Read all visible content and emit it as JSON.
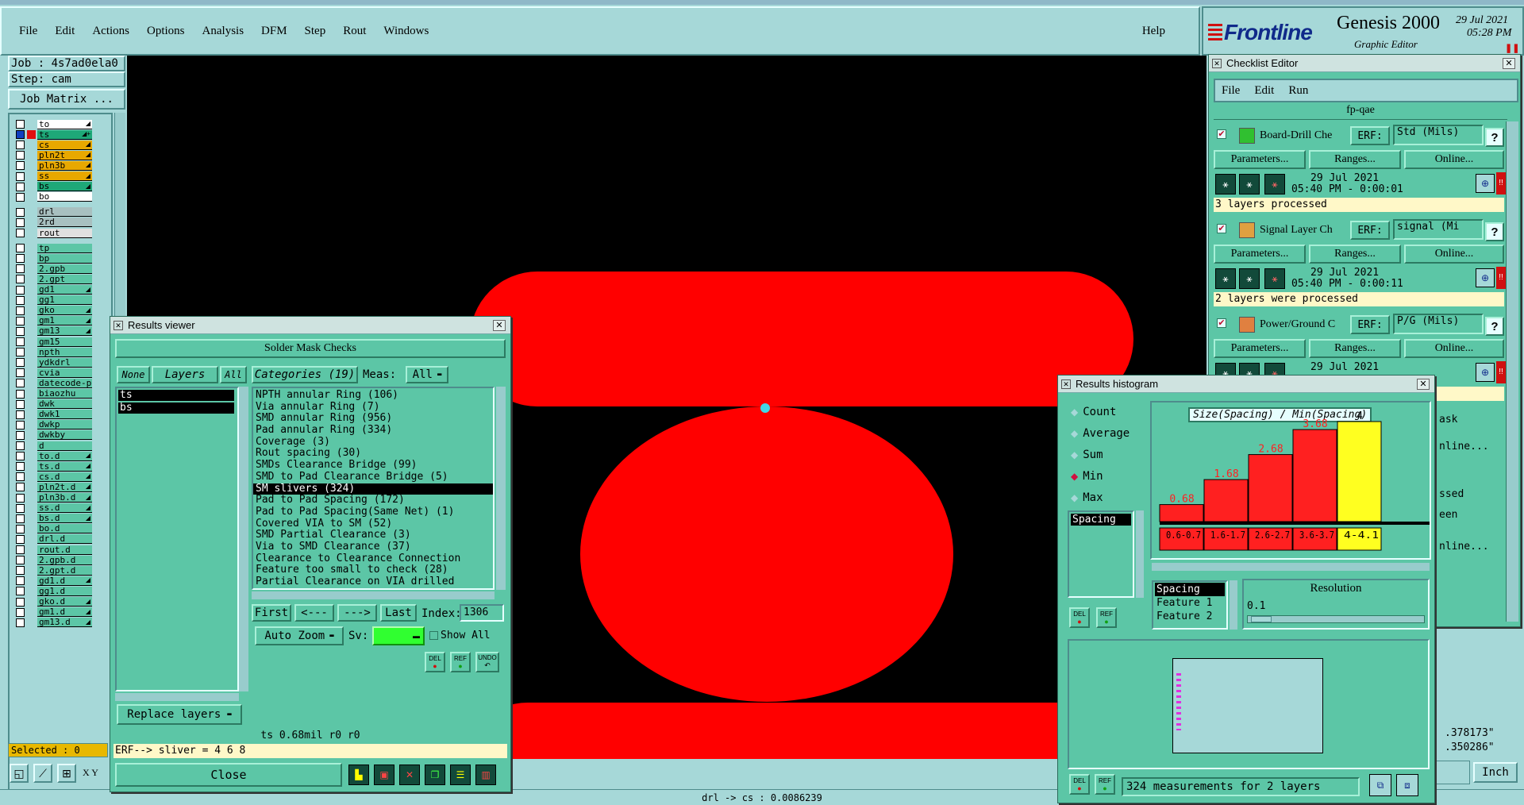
{
  "app": {
    "menu": [
      "File",
      "Edit",
      "Actions",
      "Options",
      "Analysis",
      "DFM",
      "Step",
      "Rout",
      "Windows"
    ],
    "help": "Help",
    "brand": "Frontline",
    "product": "Genesis 2000",
    "subtitle": "Graphic Editor",
    "date": "29 Jul 2021",
    "time": "05:28 PM"
  },
  "job": {
    "job": "Job : 4s7ad0ela0",
    "step": "Step: cam",
    "matrix": "Job Matrix ..."
  },
  "layers": [
    {
      "name": "to",
      "color": "#ffffff",
      "arrow": "◢"
    },
    {
      "name": "ts",
      "color": "#1ea878",
      "arrow": "◢+",
      "active": true
    },
    {
      "name": "cs",
      "color": "#e8a800",
      "arrow": "◢"
    },
    {
      "name": "pln2t",
      "color": "#e8a800",
      "arrow": "◢"
    },
    {
      "name": "pln3b",
      "color": "#e8a800",
      "arrow": "◢"
    },
    {
      "name": "ss",
      "color": "#e8a800",
      "arrow": "◢"
    },
    {
      "name": "bs",
      "color": "#1ea878",
      "arrow": "◢"
    },
    {
      "name": "bo",
      "color": "#ffffff",
      "arrow": ""
    },
    {
      "name": "drl",
      "color": "#a8c0c0",
      "arrow": ""
    },
    {
      "name": "2rd",
      "color": "#a8c0c0",
      "arrow": ""
    },
    {
      "name": "rout",
      "color": "#e0e0e0",
      "arrow": ""
    },
    {
      "name": "tp",
      "color": "#5cc6a6",
      "arrow": ""
    },
    {
      "name": "bp",
      "color": "#5cc6a6",
      "arrow": ""
    },
    {
      "name": "2.gpb",
      "color": "#5cc6a6",
      "arrow": ""
    },
    {
      "name": "2.gpt",
      "color": "#5cc6a6",
      "arrow": ""
    },
    {
      "name": "gd1",
      "color": "#5cc6a6",
      "arrow": "◢"
    },
    {
      "name": "gg1",
      "color": "#5cc6a6",
      "arrow": ""
    },
    {
      "name": "gko",
      "color": "#5cc6a6",
      "arrow": "◢"
    },
    {
      "name": "gm1",
      "color": "#5cc6a6",
      "arrow": "◢"
    },
    {
      "name": "gm13",
      "color": "#5cc6a6",
      "arrow": "◢"
    },
    {
      "name": "gm15",
      "color": "#5cc6a6",
      "arrow": ""
    },
    {
      "name": "npth",
      "color": "#5cc6a6",
      "arrow": ""
    },
    {
      "name": "ydkdrl",
      "color": "#5cc6a6",
      "arrow": ""
    },
    {
      "name": "cvia",
      "color": "#5cc6a6",
      "arrow": ""
    },
    {
      "name": "datecode-pt",
      "color": "#5cc6a6",
      "arrow": ""
    },
    {
      "name": "biaozhu",
      "color": "#5cc6a6",
      "arrow": ""
    },
    {
      "name": "dwk",
      "color": "#5cc6a6",
      "arrow": ""
    },
    {
      "name": "dwk1",
      "color": "#5cc6a6",
      "arrow": ""
    },
    {
      "name": "dwkp",
      "color": "#5cc6a6",
      "arrow": ""
    },
    {
      "name": "dwkby",
      "color": "#5cc6a6",
      "arrow": ""
    },
    {
      "name": "d",
      "color": "#5cc6a6",
      "arrow": ""
    },
    {
      "name": "to.d",
      "color": "#5cc6a6",
      "arrow": "◢"
    },
    {
      "name": "ts.d",
      "color": "#5cc6a6",
      "arrow": "◢"
    },
    {
      "name": "cs.d",
      "color": "#5cc6a6",
      "arrow": "◢"
    },
    {
      "name": "pln2t.d",
      "color": "#5cc6a6",
      "arrow": "◢"
    },
    {
      "name": "pln3b.d",
      "color": "#5cc6a6",
      "arrow": "◢"
    },
    {
      "name": "ss.d",
      "color": "#5cc6a6",
      "arrow": "◢"
    },
    {
      "name": "bs.d",
      "color": "#5cc6a6",
      "arrow": "◢"
    },
    {
      "name": "bo.d",
      "color": "#5cc6a6",
      "arrow": ""
    },
    {
      "name": "drl.d",
      "color": "#5cc6a6",
      "arrow": ""
    },
    {
      "name": "rout.d",
      "color": "#5cc6a6",
      "arrow": ""
    },
    {
      "name": "2.gpb.d",
      "color": "#5cc6a6",
      "arrow": ""
    },
    {
      "name": "2.gpt.d",
      "color": "#5cc6a6",
      "arrow": ""
    },
    {
      "name": "gd1.d",
      "color": "#5cc6a6",
      "arrow": "◢"
    },
    {
      "name": "gg1.d",
      "color": "#5cc6a6",
      "arrow": ""
    },
    {
      "name": "gko.d",
      "color": "#5cc6a6",
      "arrow": "◢"
    },
    {
      "name": "gm1.d",
      "color": "#5cc6a6",
      "arrow": "◢"
    },
    {
      "name": "gm13.d",
      "color": "#5cc6a6",
      "arrow": "◢"
    }
  ],
  "selected": "Selected : 0",
  "statusbar": "drl -> cs : 0.0086239",
  "coords": {
    "x": ".378173\"",
    "y": ".350286\"",
    "unit": "Inch"
  },
  "xy_label": "X Y",
  "results_viewer": {
    "title": "Results viewer",
    "header": "Solder Mask Checks",
    "none": "None",
    "layers": "Layers",
    "all": "All",
    "categories_label": "Categories (19)",
    "meas_label": "Meas:",
    "meas_value": "All",
    "layer_list": [
      "ts",
      "bs"
    ],
    "categories": [
      "NPTH annular Ring (106)",
      "Via annular Ring (7)",
      "SMD annular Ring (956)",
      "Pad annular Ring (334)",
      "Coverage (3)",
      "Rout spacing (30)",
      "SMDs Clearance Bridge (99)",
      "SMD to Pad Clearance Bridge (5)",
      "SM slivers (324)",
      "Pad to Pad Spacing (172)",
      "Pad to Pad Spacing(Same Net) (1)",
      "Covered VIA to SM (52)",
      "SMD Partial Clearance (3)",
      "Via to SMD Clearance (37)",
      "Clearance to Clearance Connection",
      "Feature too small to check (28)",
      "Partial Clearance on VIA drilled"
    ],
    "selected_index": 8,
    "first": "First",
    "prev": "<---",
    "next": "--->",
    "last": "Last",
    "index_label": "Index:",
    "index_value": "1306",
    "autozoom": "Auto Zoom",
    "sv": "Sv:",
    "show_all": "Show All",
    "del": "DEL",
    "ref": "REF",
    "undo": "UNDO",
    "replace": "Replace layers",
    "info": "ts 0.68mil  r0  r0",
    "erf": "ERF--> sliver = 4 6 8",
    "close": "Close"
  },
  "checklist": {
    "title": "Checklist Editor",
    "menu": [
      "File",
      "Edit",
      "Run"
    ],
    "name": "fp-qae",
    "erf": "ERF:",
    "params": "Parameters...",
    "ranges": "Ranges...",
    "online": "Online...",
    "help": "?",
    "items": [
      {
        "name": "Board-Drill Che",
        "erf": "Std (Mils)",
        "date": "29 Jul 2021",
        "time": "05:40 PM - 0:00:01",
        "status": "3 layers processed"
      },
      {
        "name": "Signal Layer Ch",
        "erf": "signal (Mi",
        "date": "29 Jul 2021",
        "time": "05:40 PM - 0:00:11",
        "status": "2 layers were processed"
      },
      {
        "name": "Power/Ground C",
        "erf": "P/G (Mils)",
        "date": "29 Jul 2021",
        "time": "",
        "status": ""
      }
    ],
    "partial": [
      "ask",
      "nline...",
      "ssed",
      "een",
      "nline..."
    ]
  },
  "histogram": {
    "title": "Results histogram",
    "modes": [
      "Count",
      "Average",
      "Sum",
      "Min",
      "Max"
    ],
    "selected_mode": "Min",
    "side_item": "Spacing",
    "chart_title": "Size(Spacing) / Min(Spacing)",
    "resolution_label": "Resolution",
    "resolution_value": "0.1",
    "attrs": [
      "Spacing",
      "Feature 1",
      "Feature 2"
    ],
    "footer": "324 measurements for 2 layers",
    "del": "DEL",
    "ref": "REF"
  },
  "chart_data": {
    "type": "bar",
    "title": "Size(Spacing) / Min(Spacing)",
    "categories": [
      "0.6-0.7",
      "1.6-1.7",
      "2.6-2.7",
      "3.6-3.7",
      "4-4.1"
    ],
    "values": [
      0.68,
      1.68,
      2.68,
      3.68,
      4
    ],
    "labels": [
      "0.68",
      "1.68",
      "2.68",
      "3.68",
      "4"
    ],
    "highlight_index": 4,
    "ylim": [
      0,
      4
    ],
    "colors": {
      "bar": "#ff2020",
      "highlight": "#ffff20"
    }
  },
  "colors": {
    "canvas": "#000000",
    "feature": "#ff0000",
    "panel": "#5cc6a6",
    "bg": "#a6d8d8"
  }
}
